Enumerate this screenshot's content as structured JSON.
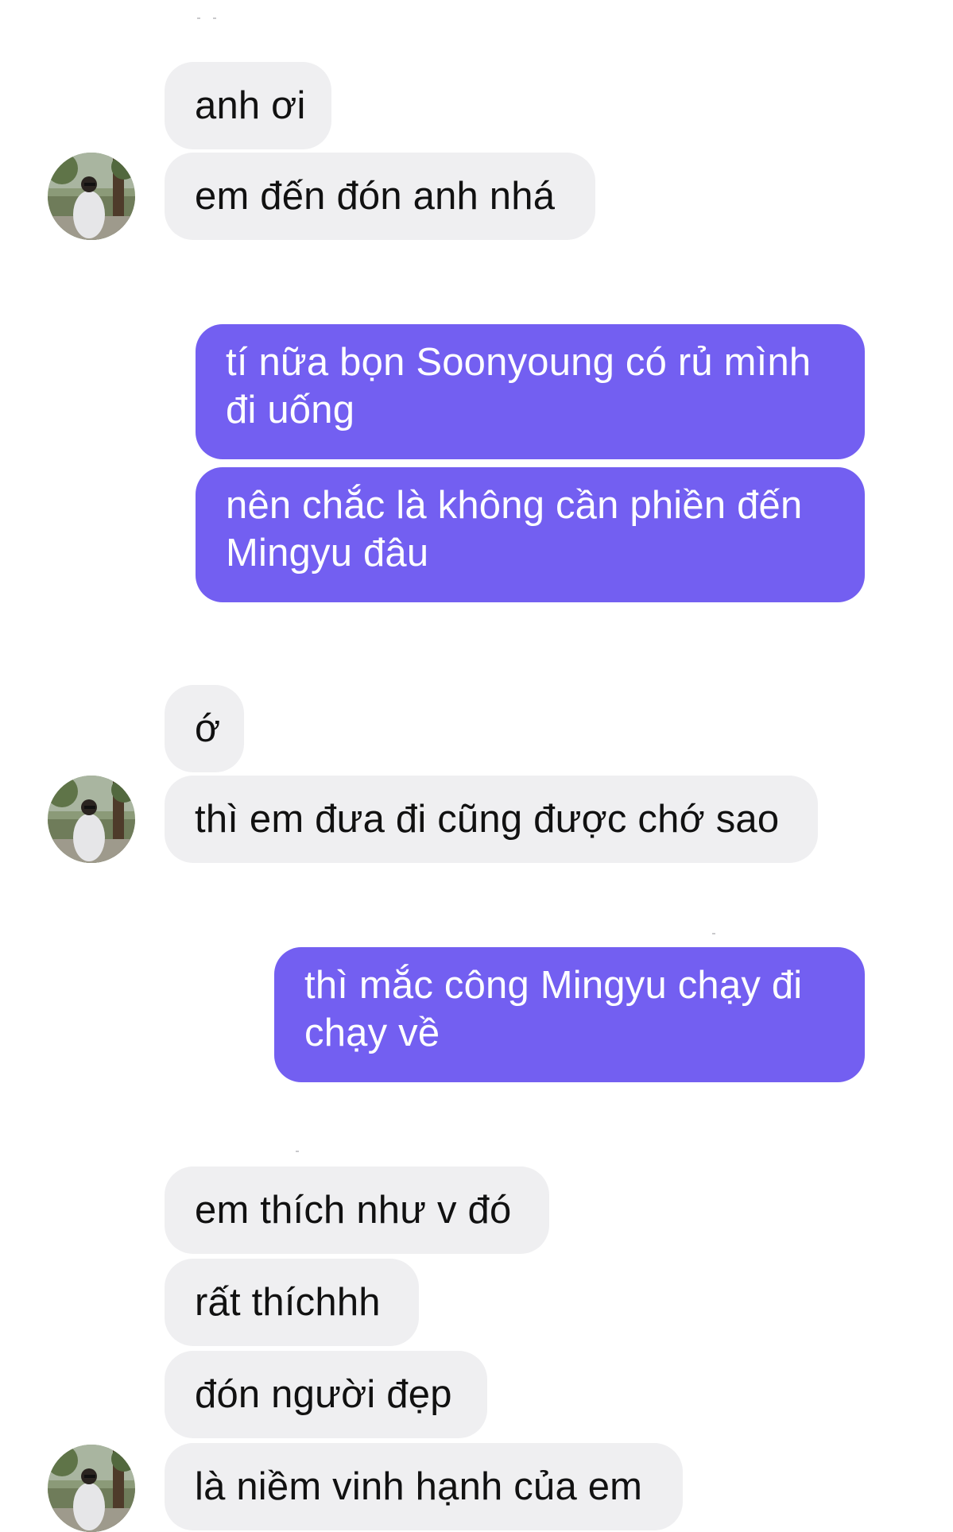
{
  "conversation": {
    "received_1": [
      "anh ơi",
      "em đến đón anh nhá"
    ],
    "sent_1": [
      "tí nữa bọn Soonyoung có rủ mình đi uống",
      "nên chắc là không cần phiền đến Mingyu đâu"
    ],
    "received_2": [
      "ớ",
      "thì em đưa đi cũng được chớ sao"
    ],
    "sent_2": [
      "thì mắc công Mingyu chạy đi chạy về"
    ],
    "received_3": [
      "em thích như v đó",
      "rất thíchhh",
      "đón người đẹp",
      "là niềm vinh hạnh của em"
    ]
  },
  "colors": {
    "incoming_bubble": "#efeff1",
    "outgoing_bubble": "#735ff1",
    "incoming_text": "#111111",
    "outgoing_text": "#ffffff"
  },
  "icons": {
    "avatar": "contact-avatar-photo"
  }
}
